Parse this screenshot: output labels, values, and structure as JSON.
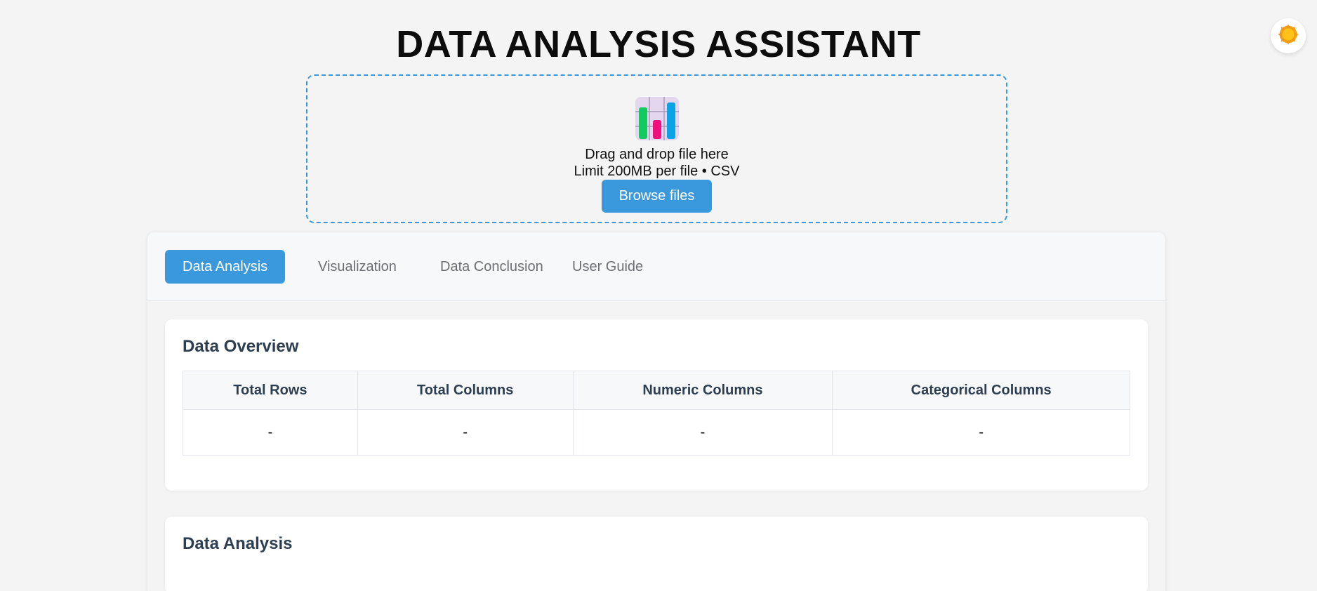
{
  "app": {
    "title": "DATA ANALYSIS ASSISTANT",
    "theme_toggle_icon": "sun-icon"
  },
  "upload": {
    "icon": "bar-chart-icon",
    "drag_text": "Drag and drop file here",
    "limit_text": "Limit 200MB per file • CSV",
    "browse_label": "Browse files"
  },
  "tabs": [
    {
      "label": "Data Analysis",
      "active": true
    },
    {
      "label": "Visualization",
      "active": false
    },
    {
      "label": "Data Conclusion",
      "active": false
    },
    {
      "label": "User Guide",
      "active": false
    }
  ],
  "overview": {
    "title": "Data Overview",
    "columns": [
      "Total Rows",
      "Total Columns",
      "Numeric Columns",
      "Categorical Columns"
    ],
    "values": [
      "-",
      "-",
      "-",
      "-"
    ]
  },
  "analysis": {
    "title": "Data Analysis"
  },
  "colors": {
    "accent": "#3a98dc",
    "background": "#f4f4f4",
    "heading": "#2c3e50",
    "tab_inactive": "#6b6f73"
  }
}
